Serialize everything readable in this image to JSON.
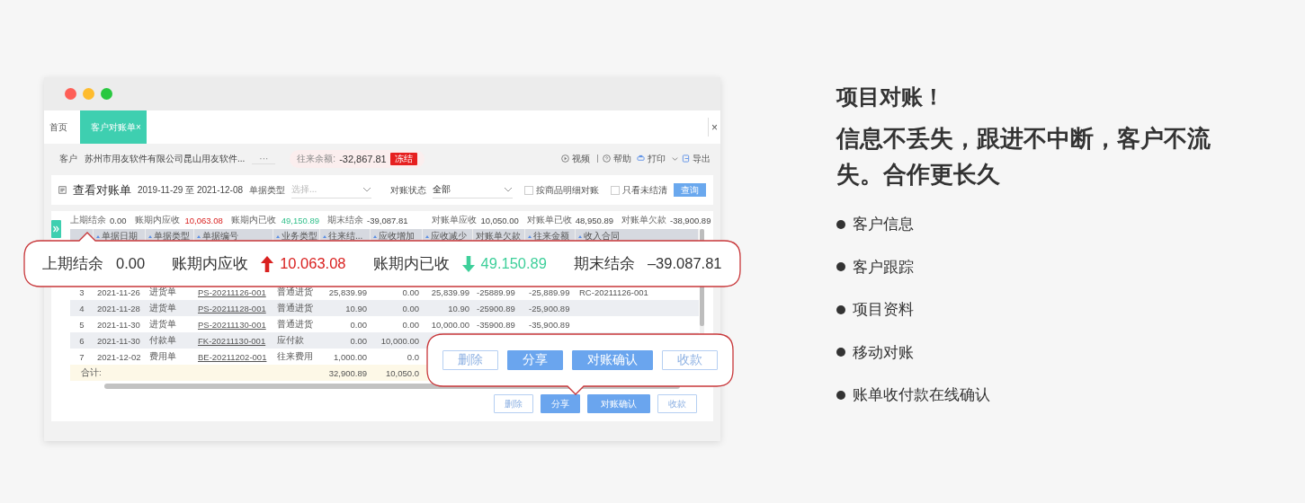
{
  "app": {
    "tabs": [
      {
        "label": "首页",
        "selected": false
      },
      {
        "label": "客户对账单",
        "selected": true,
        "close": "×"
      }
    ],
    "window_close": "×",
    "customer": {
      "label": "客户",
      "value": "苏州市用友软件有限公司昆山用友软件...",
      "more": "···",
      "balance_label": "往来余额:",
      "balance": "-32,867.81",
      "badge": "冻结"
    },
    "toolbar": [
      "视频",
      "帮助",
      "打印",
      "导出"
    ],
    "filter": {
      "title": "查看对账单",
      "date_range": "2019-11-29 至 2021-12-08",
      "type_label": "单据类型",
      "type_placeholder": "选择...",
      "status_label": "对账状态",
      "status_value": "全部",
      "checkboxes": [
        {
          "label": "按商品明细对账",
          "checked": false
        },
        {
          "label": "只看未结清",
          "checked": false
        }
      ],
      "query_button": "查询"
    },
    "summary": [
      {
        "label": "上期结余",
        "value": "0.00",
        "kind": "plain"
      },
      {
        "label": "账期内应收",
        "value": "10,063.08",
        "kind": "up"
      },
      {
        "label": "账期内已收",
        "value": "49,150.89",
        "kind": "down"
      },
      {
        "label": "期末结余",
        "value": "-39,087.81",
        "kind": "plain"
      }
    ],
    "summary_right": [
      {
        "label": "对账单应收",
        "value": "10,050.00"
      },
      {
        "label": "对账单已收",
        "value": "48,950.89"
      },
      {
        "label": "对账单欠款",
        "value": "-38,900.89"
      }
    ],
    "table": {
      "columns": [
        {
          "kind": "index",
          "sortable": false
        },
        {
          "label": "单据日期",
          "sortable": true,
          "kind": "text"
        },
        {
          "label": "单据类型",
          "sortable": true,
          "kind": "text"
        },
        {
          "label": "单据编号",
          "sortable": true,
          "kind": "link"
        },
        {
          "label": "业务类型",
          "sortable": true,
          "kind": "text"
        },
        {
          "label": "往来结...",
          "sortable": true,
          "kind": "number"
        },
        {
          "label": "应收增加",
          "sortable": true,
          "kind": "number"
        },
        {
          "label": "应收减少",
          "sortable": true,
          "kind": "number"
        },
        {
          "label": "对账单欠款",
          "sortable": false,
          "kind": "text"
        },
        {
          "label": "往来金额",
          "sortable": true,
          "kind": "text"
        },
        {
          "label": "收入合同",
          "sortable": true,
          "kind": "text"
        }
      ],
      "rows": [
        [
          "3",
          "2021-11-26",
          "进货单",
          "PS-20211126-001",
          "普通进货",
          "25,839.99",
          "0.00",
          "25,839.99",
          "-25889.99",
          "-25,889.99",
          "RC-20211126-001"
        ],
        [
          "4",
          "2021-11-28",
          "进货单",
          "PS-20211128-001",
          "普通进货",
          "10.90",
          "0.00",
          "10.90",
          "-25900.89",
          "-25,900.89"
        ],
        [
          "5",
          "2021-11-30",
          "进货单",
          "PS-20211130-001",
          "普通进货",
          "0.00",
          "0.00",
          "10,000.00",
          "-35900.89",
          "-35,900.89"
        ],
        [
          "6",
          "2021-11-30",
          "付款单",
          "FK-20211130-001",
          "应付款",
          "0.00",
          "10,000.00"
        ],
        [
          "7",
          "2021-12-02",
          "费用单",
          "BE-20211202-001",
          "往来费用",
          "1,000.00",
          "0.0"
        ]
      ],
      "total": {
        "label": "合计:",
        "cells": [
          "32,900.89",
          "10,050.0"
        ]
      }
    },
    "actions": [
      {
        "label": "删除",
        "kind": "outline"
      },
      {
        "label": "分享",
        "kind": "primary"
      },
      {
        "label": "对账确认",
        "kind": "primary"
      },
      {
        "label": "收款",
        "kind": "outline"
      }
    ]
  },
  "callout_summary": [
    {
      "label": "上期结余",
      "value": "0.00",
      "kind": "plain"
    },
    {
      "label": "账期内应收",
      "value": "10.063.08",
      "kind": "up"
    },
    {
      "label": "账期内已收",
      "value": "49.150.89",
      "kind": "down"
    },
    {
      "label": "期末结余",
      "value": "–39.087.81",
      "kind": "plain"
    }
  ],
  "callout_actions": [
    {
      "label": "删除",
      "kind": "outline"
    },
    {
      "label": "分享",
      "kind": "primary"
    },
    {
      "label": "对账确认",
      "kind": "primary"
    },
    {
      "label": "收款",
      "kind": "outline"
    }
  ],
  "title": "项目对账！",
  "subtitle": "信息不丢失，跟进不中断，客户不流失。合作更长久",
  "features": [
    "客户信息",
    "客户跟踪",
    "项目资料",
    "移动对账",
    "账单收付款在线确认"
  ]
}
